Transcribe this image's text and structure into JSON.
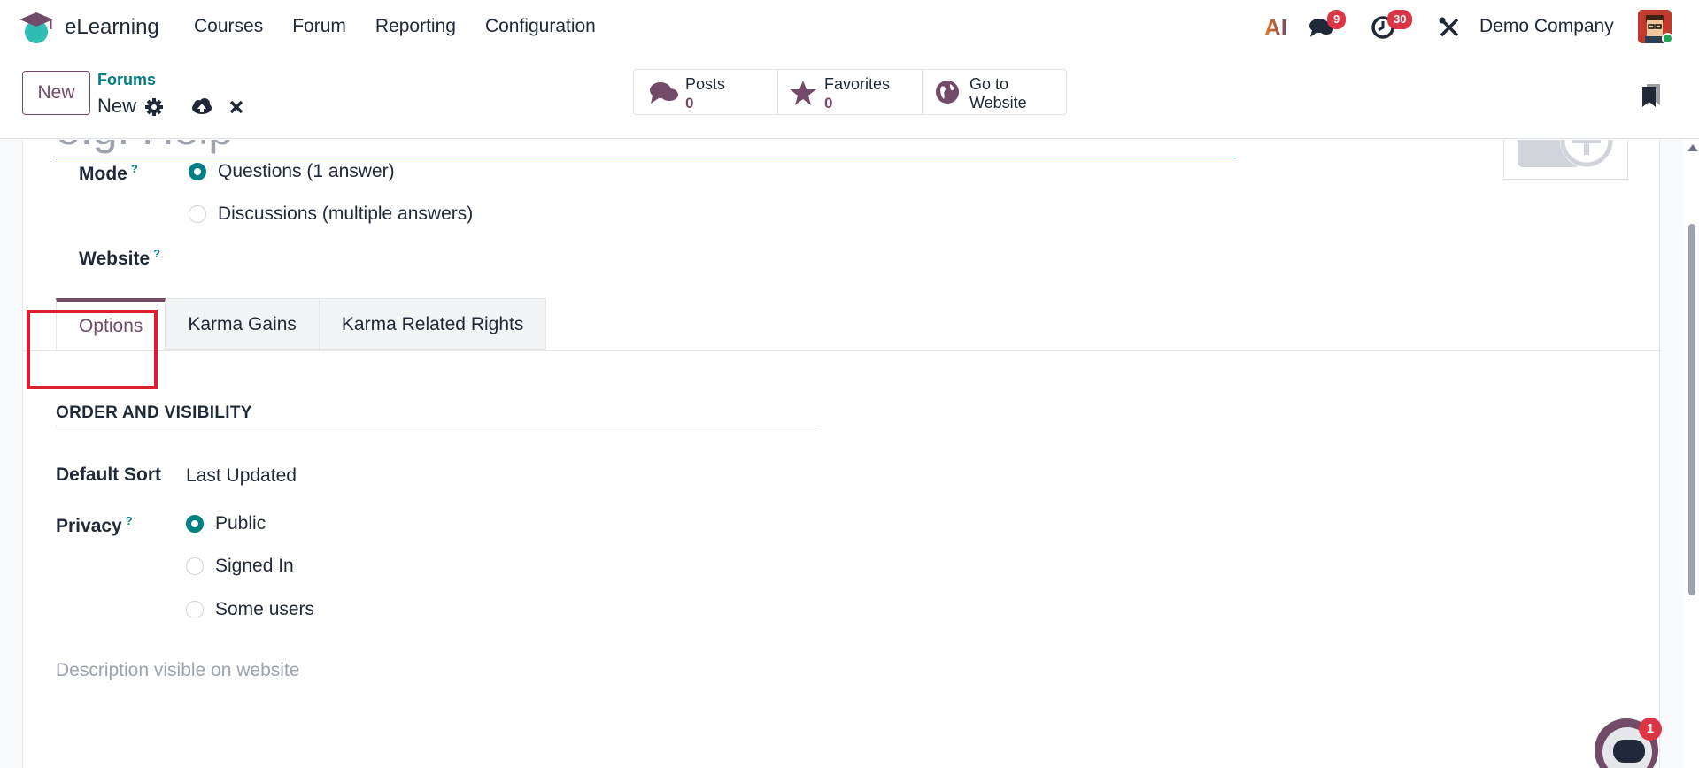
{
  "navbar": {
    "app_name": "eLearning",
    "menu": [
      "Courses",
      "Forum",
      "Reporting",
      "Configuration"
    ],
    "ai_label": "AI",
    "messages_count": "9",
    "activities_count": "30",
    "company": "Demo Company"
  },
  "control_panel": {
    "new_label": "New",
    "breadcrumb": "Forums",
    "record_name": "New",
    "stat_buttons": [
      {
        "label": "Posts",
        "value": "0",
        "icon": "comments-icon"
      },
      {
        "label": "Favorites",
        "value": "0",
        "icon": "star-icon"
      },
      {
        "label": "Go to",
        "label2": "Website",
        "icon": "globe-icon"
      }
    ]
  },
  "form": {
    "name_placeholder": "e.g. Help",
    "mode_label": "Mode",
    "help_mark": "?",
    "mode_options": [
      "Questions (1 answer)",
      "Discussions (multiple answers)"
    ],
    "mode_selected": 0,
    "website_label": "Website",
    "tabs": [
      "Options",
      "Karma Gains",
      "Karma Related Rights"
    ],
    "active_tab": 0,
    "section_title": "ORDER AND VISIBILITY",
    "default_sort_label": "Default Sort",
    "default_sort_value": "Last Updated",
    "privacy_label": "Privacy",
    "privacy_options": [
      "Public",
      "Signed In",
      "Some users"
    ],
    "privacy_selected": 0,
    "description_placeholder": "Description visible on website"
  },
  "chatbot": {
    "badge": "1"
  },
  "colors": {
    "brand": "#714b67",
    "accent": "#017e84",
    "highlight": "#dc1e2d",
    "badge": "#dc3545"
  }
}
